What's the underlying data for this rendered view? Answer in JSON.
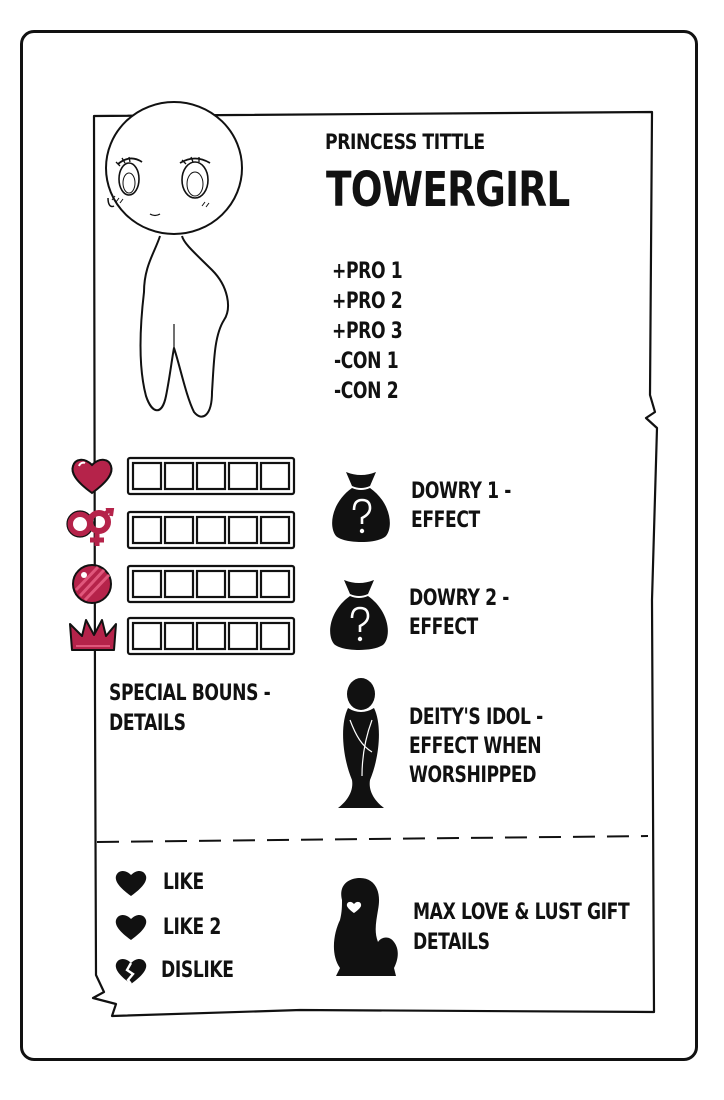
{
  "card": {
    "subtitle": "PRINCESS TITTLE",
    "name": "TOWERGIRL"
  },
  "traits": [
    "+PRO 1",
    "+PRO 2",
    "+PRO 3",
    "-CON 1",
    "-CON 2"
  ],
  "stats": [
    {
      "icon": "heart-icon",
      "cells": 5,
      "filled": 0
    },
    {
      "icon": "lust-symbol-icon",
      "cells": 5,
      "filled": 0
    },
    {
      "icon": "candy-orb-icon",
      "cells": 5,
      "filled": 0
    },
    {
      "icon": "crown-icon",
      "cells": 5,
      "filled": 0
    }
  ],
  "dowries": [
    {
      "line1": "DOWRY 1 -",
      "line2": "EFFECT"
    },
    {
      "line1": "DOWRY 2 -",
      "line2": "EFFECT"
    }
  ],
  "special": {
    "line1": "SPECIAL BOUNS -",
    "line2": "DETAILS"
  },
  "idol": {
    "line1": "DEITY'S IDOL -",
    "line2": "EFFECT WHEN",
    "line3": "WORSHIPPED"
  },
  "preferences": [
    {
      "icon": "heart-icon",
      "label": "LIKE"
    },
    {
      "icon": "heart-icon",
      "label": "LIKE 2"
    },
    {
      "icon": "broken-heart-icon",
      "label": "DISLIKE"
    }
  ],
  "gift": {
    "line1": "MAX LOVE & LUST GIFT",
    "line2": "DETAILS"
  },
  "colors": {
    "accent": "#b5234a",
    "ink": "#111111",
    "paper": "#ffffff"
  }
}
